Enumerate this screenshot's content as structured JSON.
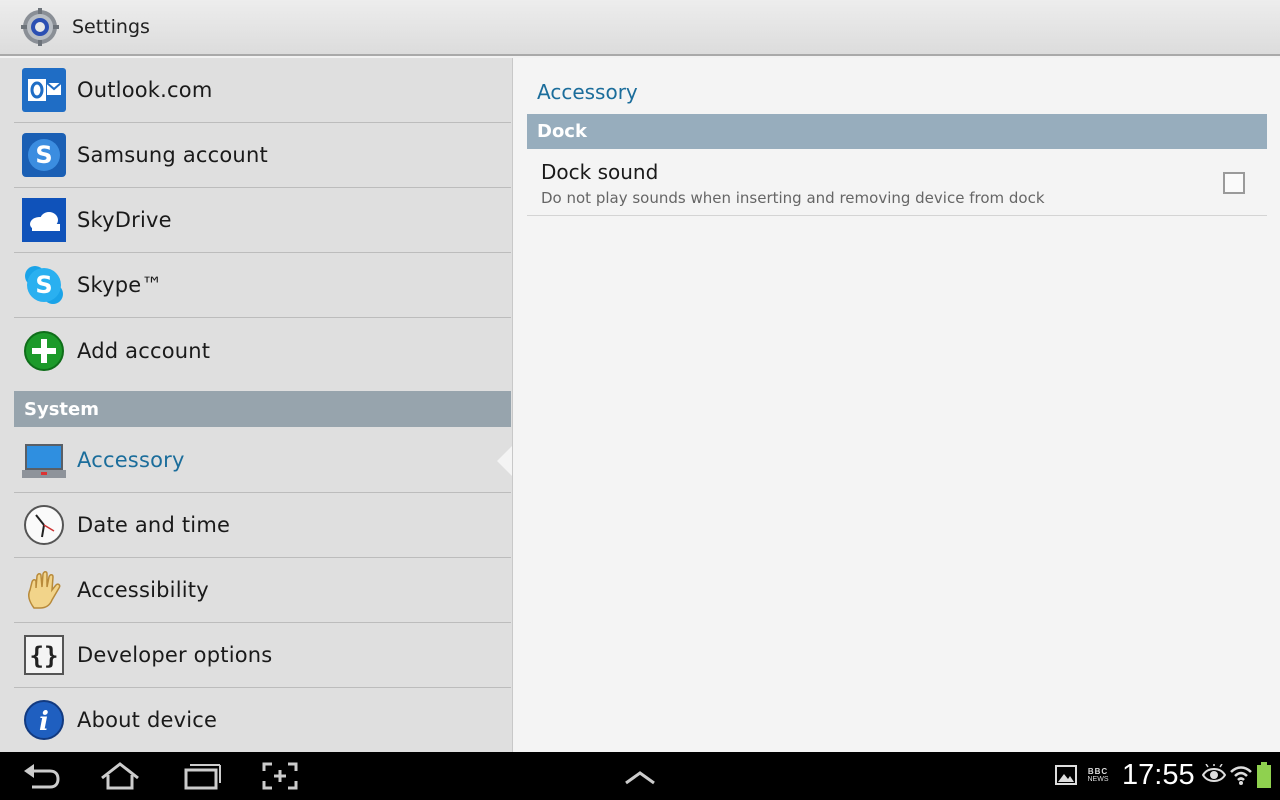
{
  "actionbar": {
    "title": "Settings",
    "icon": "settings-gear-icon"
  },
  "left_menu": {
    "items_top": [
      {
        "label": "Outlook.com",
        "icon": "outlook-icon"
      },
      {
        "label": "Samsung account",
        "icon": "samsung-account-icon"
      },
      {
        "label": "SkyDrive",
        "icon": "skydrive-icon"
      },
      {
        "label": "Skype™",
        "icon": "skype-icon"
      },
      {
        "label": "Add account",
        "icon": "add-icon"
      }
    ],
    "section_header": "System",
    "items_system": [
      {
        "label": "Accessory",
        "icon": "accessory-icon",
        "selected": true
      },
      {
        "label": "Date and time",
        "icon": "clock-icon"
      },
      {
        "label": "Accessibility",
        "icon": "hand-icon"
      },
      {
        "label": "Developer options",
        "icon": "braces-icon"
      },
      {
        "label": "About device",
        "icon": "info-icon"
      }
    ]
  },
  "detail": {
    "title": "Accessory",
    "category": "Dock",
    "preference": {
      "title": "Dock sound",
      "summary": "Do not play sounds when inserting and removing device from dock",
      "checked": false
    }
  },
  "sysbar": {
    "nav": [
      "back-icon",
      "home-icon",
      "recent-apps-icon",
      "screenshot-icon",
      "expand-up-icon"
    ],
    "status": [
      "gallery-icon",
      "bbc-news-icon",
      "eye-icon",
      "wifi-icon",
      "battery-icon"
    ],
    "clock": "17:55",
    "bbc_top": "BBC",
    "bbc_bottom": "NEWS"
  },
  "colors": {
    "accent": "#1b6d9b",
    "section_header_bg": "#97a4ad",
    "category_header_bg": "#97adbd"
  }
}
